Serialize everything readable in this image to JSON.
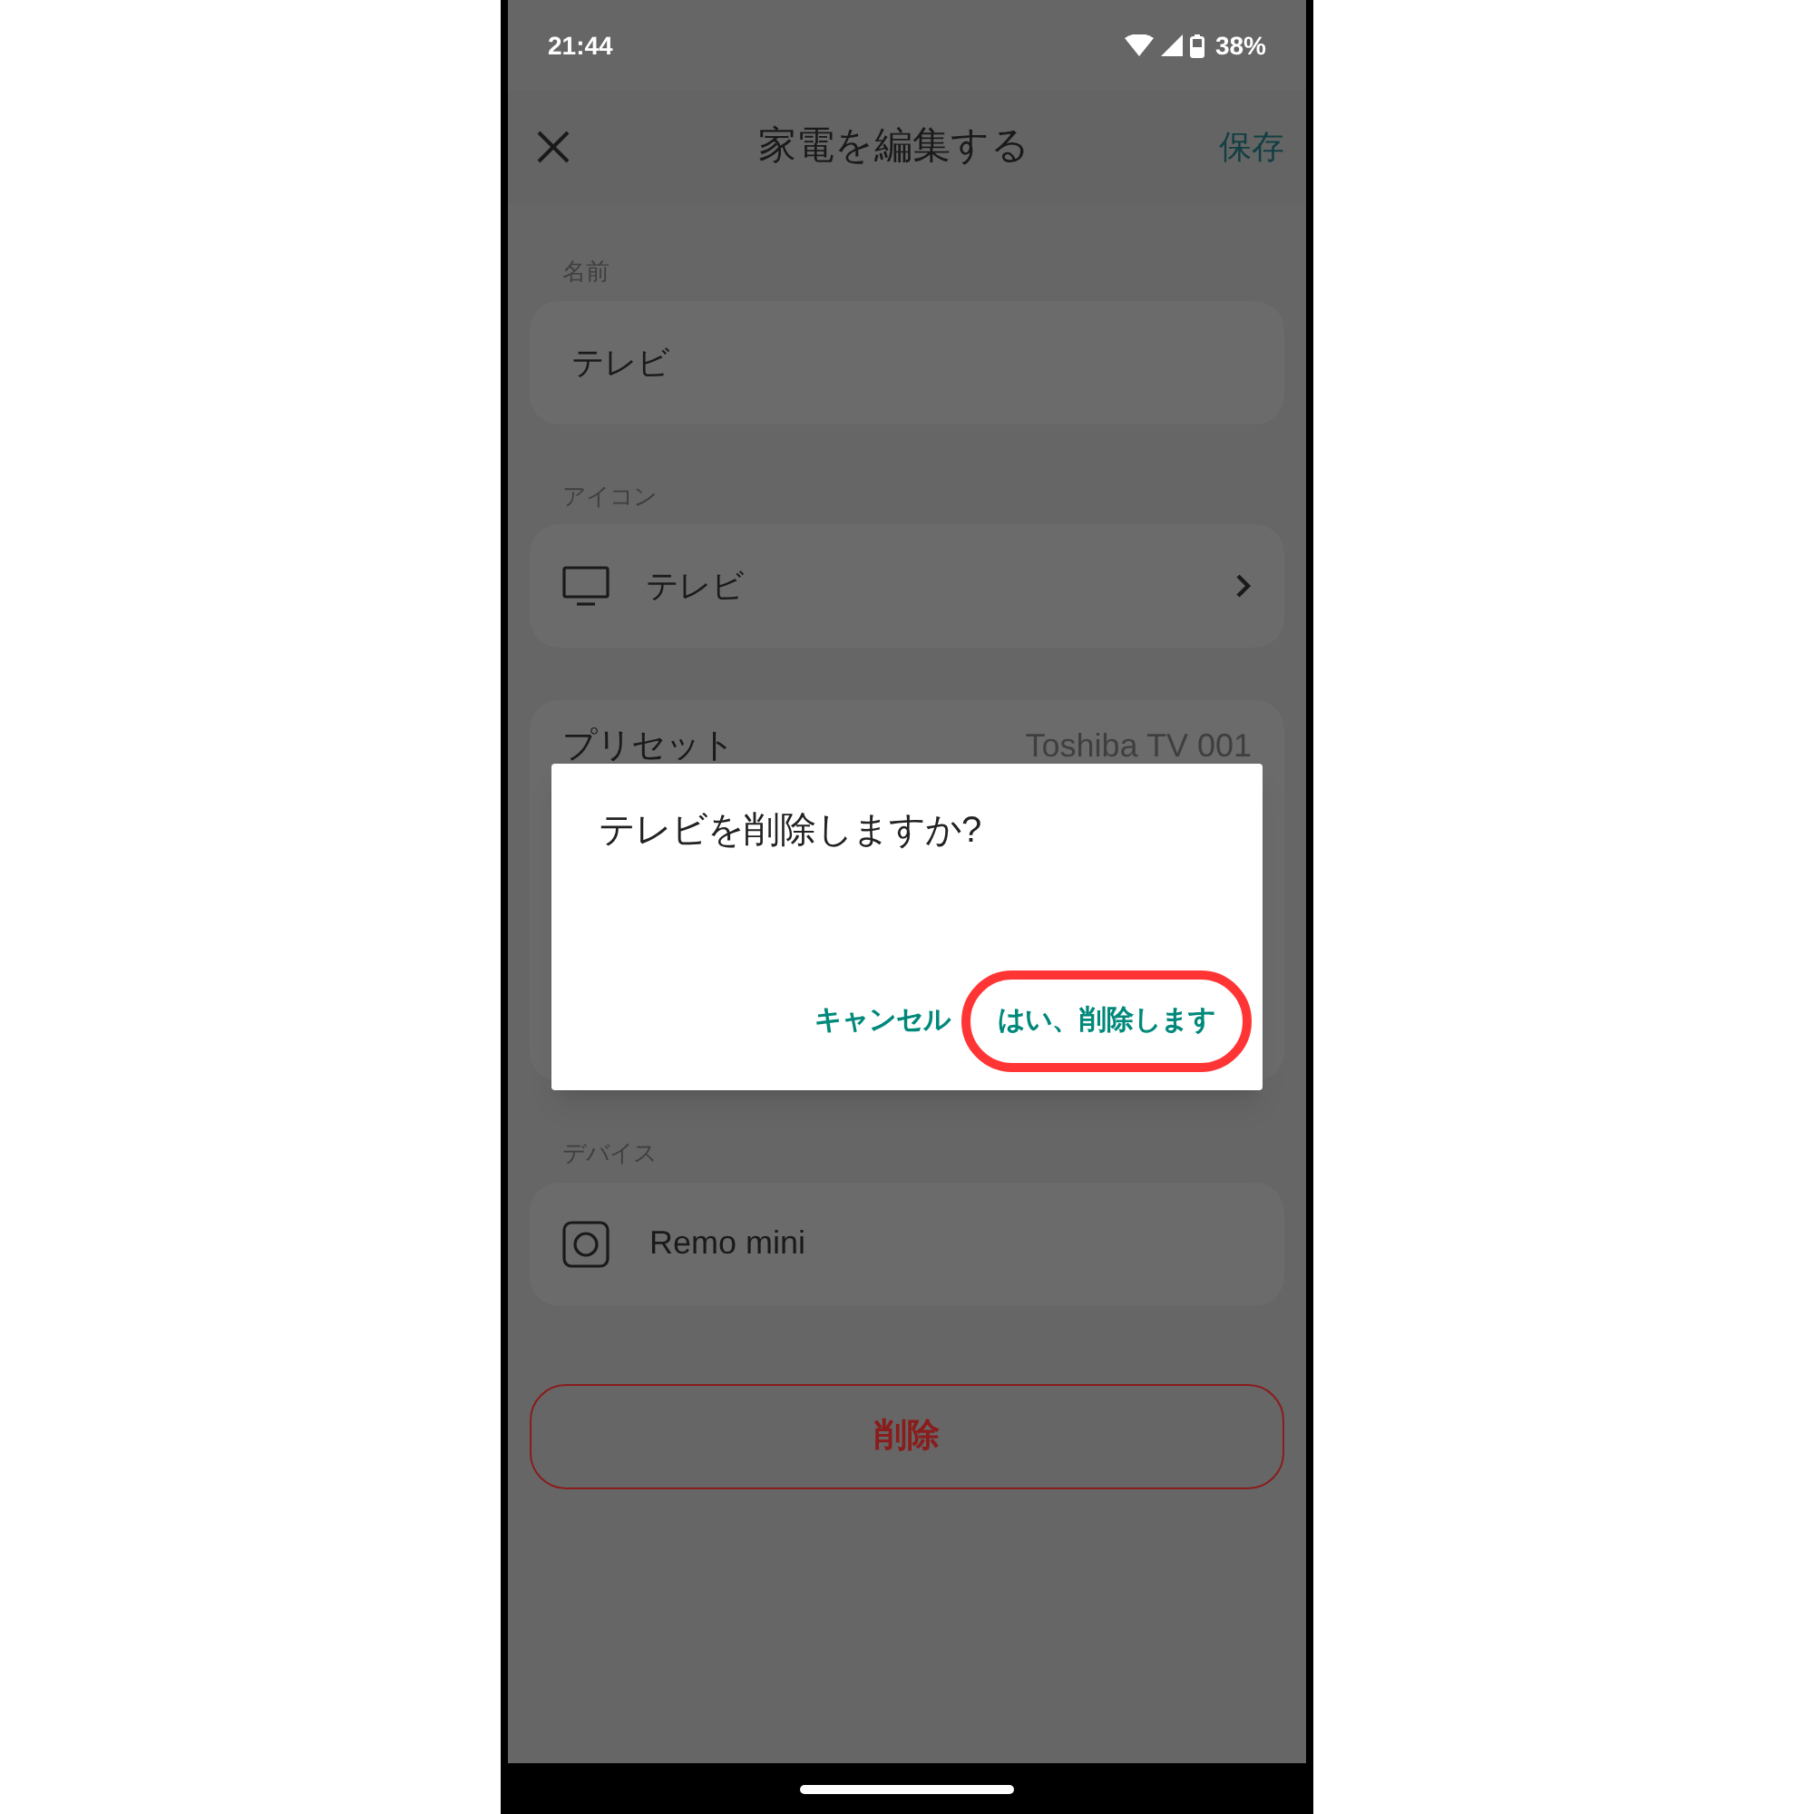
{
  "status_bar": {
    "time": "21:44",
    "battery": "38%"
  },
  "header": {
    "title": "家電を編集する",
    "save": "保存"
  },
  "name_field": {
    "label": "名前",
    "value": "テレビ"
  },
  "icon_field": {
    "label": "アイコン",
    "value": "テレビ"
  },
  "preset": {
    "label": "プリセット",
    "value": "Toshiba TV 001"
  },
  "device_field": {
    "label": "デバイス",
    "value": "Remo mini"
  },
  "delete_button": "削除",
  "dialog": {
    "title": "テレビを削除しますか?",
    "buttons": [
      {
        "label": "キャンセル",
        "highlighted": false
      },
      {
        "label": "はい、削除します",
        "highlighted": true
      }
    ]
  }
}
